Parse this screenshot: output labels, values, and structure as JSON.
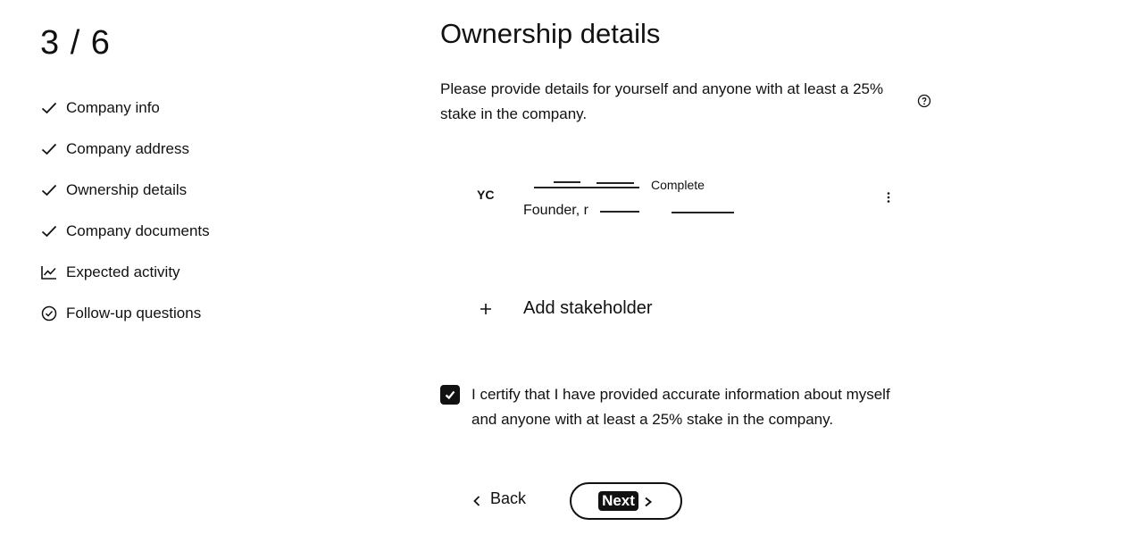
{
  "progress": {
    "counter": "3 / 6"
  },
  "steps": [
    {
      "label": "Company info",
      "icon": "check-icon"
    },
    {
      "label": "Company address",
      "icon": "check-icon"
    },
    {
      "label": "Ownership details",
      "icon": "check-icon"
    },
    {
      "label": "Company documents",
      "icon": "check-icon"
    },
    {
      "label": "Expected activity",
      "icon": "chart-line-icon"
    },
    {
      "label": "Follow-up questions",
      "icon": "circle-check-icon"
    }
  ],
  "main": {
    "title": "Ownership details",
    "intro": "Please provide details for yourself and anyone with at least a 25% stake in the company.",
    "stakeholder": {
      "initials": "YC",
      "status": "Complete",
      "role": "Founder, r"
    },
    "add_label": "Add stakeholder",
    "certify_text": "I certify that I have provided accurate information about myself and anyone with at least a 25% stake in the company.",
    "certify_checked": true
  },
  "footer": {
    "back_label": "Back",
    "next_label": "Next"
  }
}
